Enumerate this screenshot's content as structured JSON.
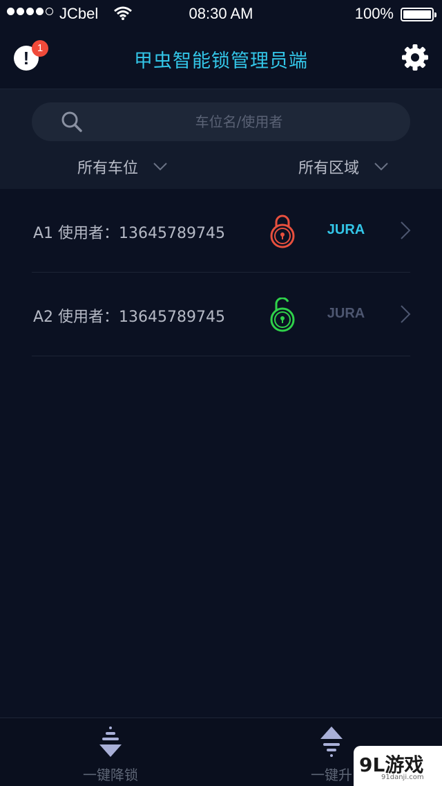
{
  "status_bar": {
    "carrier": "JCbel",
    "time": "08:30 AM",
    "battery": "100%"
  },
  "header": {
    "title": "甲虫智能锁管理员端",
    "alert_icon": "alert-icon",
    "alert_badge": "1",
    "settings_icon": "gear-icon"
  },
  "search": {
    "placeholder": "车位名/使用者"
  },
  "filters": {
    "spot_label": "所有车位",
    "area_label": "所有区域"
  },
  "spots": [
    {
      "label": "A1  使用者：13645789745",
      "lock_state": "locked",
      "lock_color": "#e8503e",
      "zone": "JURA",
      "zone_active": true
    },
    {
      "label": "A2  使用者：13645789745",
      "lock_state": "unlocked",
      "lock_color": "#2fd24a",
      "zone": "JURA",
      "zone_active": false
    }
  ],
  "bottom_actions": {
    "lower_all": "一键降锁",
    "raise_all": "一键升"
  },
  "watermark": {
    "main": "9L游戏",
    "sub": "91danji.com"
  },
  "colors": {
    "accent": "#33c6e8",
    "background": "#0b1122",
    "badge": "#f04a3a",
    "locked": "#e8503e",
    "unlocked": "#2fd24a"
  }
}
